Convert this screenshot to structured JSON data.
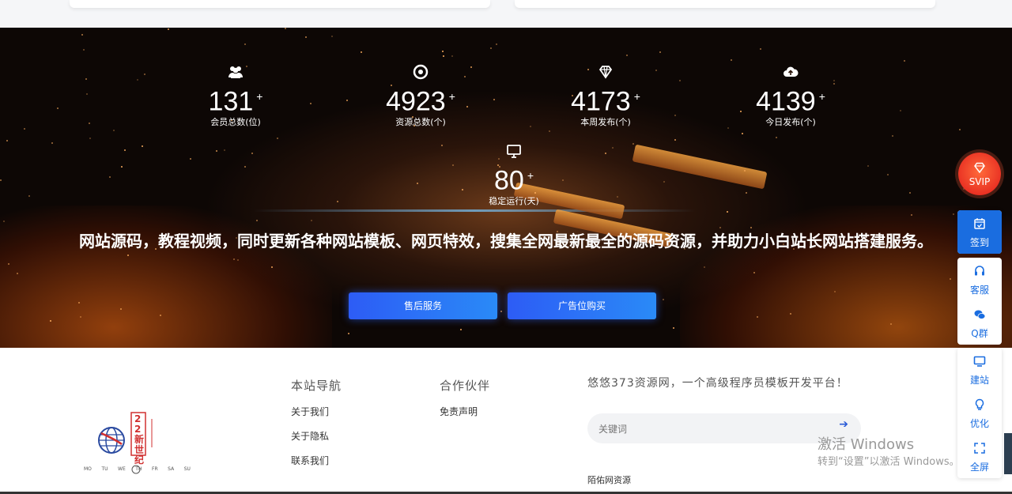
{
  "stats": [
    {
      "icon": "users-icon",
      "value": "131",
      "plus": "+",
      "label": "会员总数(位)"
    },
    {
      "icon": "chrome-icon",
      "value": "4923",
      "plus": "+",
      "label": "资源总数(个)"
    },
    {
      "icon": "diamond-icon",
      "value": "4173",
      "plus": "+",
      "label": "本周发布(个)"
    },
    {
      "icon": "cloud-upload-icon",
      "value": "4139",
      "plus": "+",
      "label": "今日发布(个)"
    },
    {
      "icon": "monitor-icon",
      "value": "80",
      "plus": "+",
      "label": "稳定运行(天)"
    }
  ],
  "slogan": "网站源码，教程视频，同时更新各种网站模板、网页特效，搜集全网最新最全的源码资源，并助力小白站长网站搭建服务。",
  "buttons": {
    "after_sales": "售后服务",
    "ad_purchase": "广告位购买"
  },
  "footer": {
    "nav_title": "本站导航",
    "nav_links": [
      "关于我们",
      "关于隐私",
      "联系我们"
    ],
    "partners_title": "合作伙伴",
    "partners_links": [
      "免责声明"
    ],
    "about_text": "悠悠373资源网，一个高级程序员模板开发平台！",
    "search_placeholder": "关键词",
    "search_arrow": "➔",
    "friend_link": "陌佑网资源"
  },
  "logo": {
    "text_vertical": "22新世纪",
    "days": [
      "MO",
      "TU",
      "WE",
      "TH",
      "FR",
      "SA",
      "SU"
    ]
  },
  "sidebar": {
    "svip": "SVIP",
    "items_a": [
      {
        "icon": "calendar-check-icon",
        "label": "签到"
      }
    ],
    "items_b": [
      {
        "icon": "headset-icon",
        "label": "客服"
      },
      {
        "icon": "wechat-icon",
        "label": "Q群"
      }
    ],
    "items_c": [
      {
        "icon": "monitor-icon",
        "label": "建站"
      },
      {
        "icon": "lightbulb-icon",
        "label": "优化"
      },
      {
        "icon": "fullscreen-icon",
        "label": "全屏"
      }
    ]
  },
  "watermark": {
    "line1": "激活 Windows",
    "line2": "转到“设置”以激活 Windows。"
  },
  "colors": {
    "primary": "#1a6de0",
    "button": "#2d5cf5",
    "svip": "#e01a1a"
  }
}
